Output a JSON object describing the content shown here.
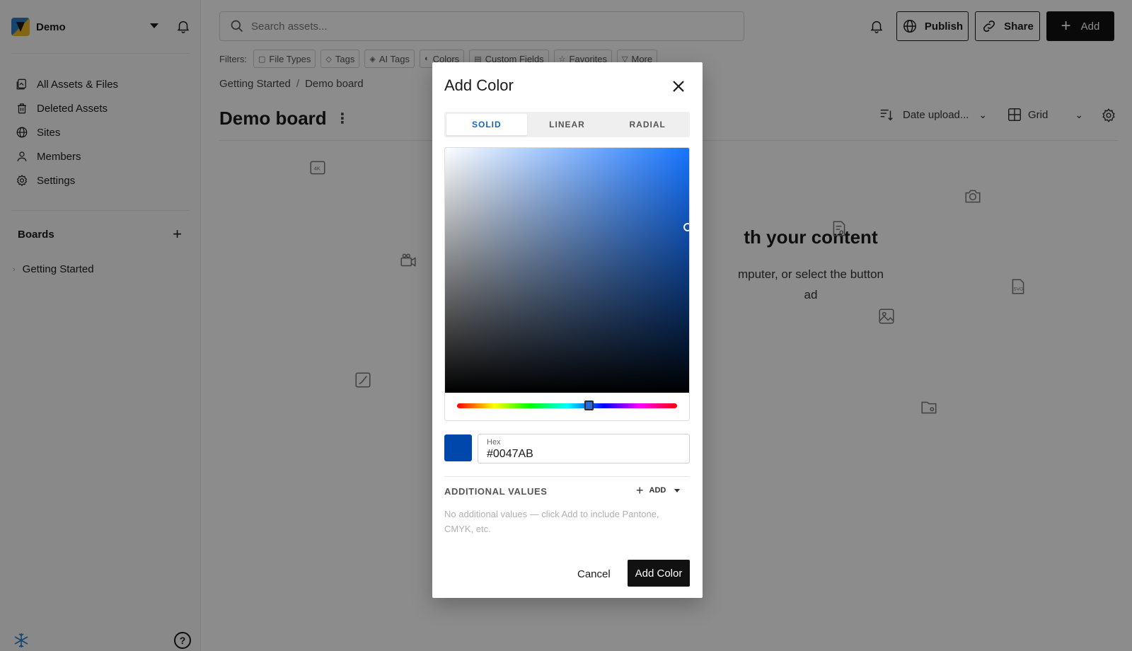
{
  "workspace": {
    "name": "Demo"
  },
  "sidebar": {
    "nav": [
      {
        "label": "All Assets & Files",
        "icon": "assets-icon"
      },
      {
        "label": "Deleted Assets",
        "icon": "trash-icon"
      },
      {
        "label": "Sites",
        "icon": "globe-icon"
      },
      {
        "label": "Members",
        "icon": "person-icon"
      },
      {
        "label": "Settings",
        "icon": "gear-icon"
      }
    ],
    "boards_title": "Boards",
    "boards": [
      {
        "label": "Getting Started"
      }
    ],
    "help_label": "?"
  },
  "header": {
    "search_placeholder": "Search assets...",
    "publish_label": "Publish",
    "share_label": "Share",
    "add_label": "Add"
  },
  "filters": {
    "label": "Filters:",
    "chips": [
      "File Types",
      "Tags",
      "AI Tags",
      "Colors",
      "Custom Fields",
      "Favorites",
      "More"
    ]
  },
  "breadcrumb": {
    "parent": "Getting Started",
    "separator": "/",
    "current": "Demo board"
  },
  "board": {
    "title": "Demo board",
    "sort_label": "Date upload...",
    "view_label": "Grid",
    "empty_title": "th your content",
    "empty_line1": "mputer, or select the button",
    "empty_line2": "ad"
  },
  "modal": {
    "title": "Add Color",
    "tabs": [
      {
        "label": "SOLID"
      },
      {
        "label": "LINEAR"
      },
      {
        "label": "RADIAL"
      }
    ],
    "active_tab": "SOLID",
    "color": {
      "hex_label": "Hex",
      "hex_value": "#0047AB",
      "hue_color": "#1774ff",
      "hue_fraction": 0.6,
      "saturation_fraction": 1.0,
      "brightness_fraction": 0.67
    },
    "additional_title": "ADDITIONAL VALUES",
    "additional_add_label": "ADD",
    "additional_hint": "No additional values — click Add to include Pantone, CMYK, etc.",
    "cancel_label": "Cancel",
    "submit_label": "Add Color"
  },
  "colors": {
    "accent_tab": "#1565c0",
    "primary_button": "#111111",
    "overlay": "rgba(0,0,0,0.45)"
  }
}
